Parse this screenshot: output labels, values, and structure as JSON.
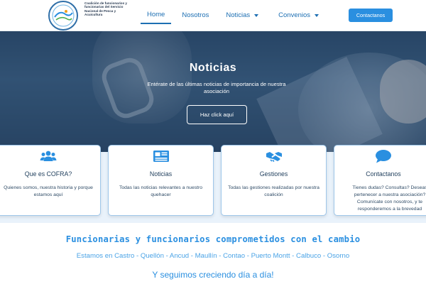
{
  "header": {
    "logo_text": "Coalición de funcionarios y funcionarias del Servicio Nacional de Pesca y Acuicultura",
    "nav": [
      {
        "label": "Home"
      },
      {
        "label": "Nosotros"
      },
      {
        "label": "Noticias"
      },
      {
        "label": "Convenios"
      }
    ],
    "contact_button": "Contactanos"
  },
  "hero": {
    "title": "Noticias",
    "subtitle": "Entérate de las últimas noticias de importancia de nuestra asociación",
    "button": "Haz click aquí"
  },
  "cards": [
    {
      "icon": "users-icon",
      "title": "Que es COFRA?",
      "text": "Quienes somos, nuestra historia y porque estamos aquí"
    },
    {
      "icon": "newspaper-icon",
      "title": "Noticias",
      "text": "Todas las noticias relevantes a nuestro quehacer"
    },
    {
      "icon": "handshake-icon",
      "title": "Gestiones",
      "text": "Todas las gestiones realizadas por nuestra coalición"
    },
    {
      "icon": "chat-bubble-icon",
      "title": "Contactanos",
      "text": "Tienes dudas? Consultas? Deseas pertenecer a nuestra asociación? Comunícate con nosotros, y te responderemos a la brevedad"
    }
  ],
  "headline": "Funcionarias y funcionarios comprometidos con el cambio",
  "cities": "Estamos en Castro - Quellón - Ancud - Maullín - Contao - Puerto Montt - Calbuco - Osorno",
  "tagline": "Y seguimos creciendo día a día!",
  "colors": {
    "accent": "#2a8fe0",
    "nav_text": "#1d6fb3",
    "card_border": "#9ec7ea",
    "band_bg": "#e9f2fb"
  }
}
